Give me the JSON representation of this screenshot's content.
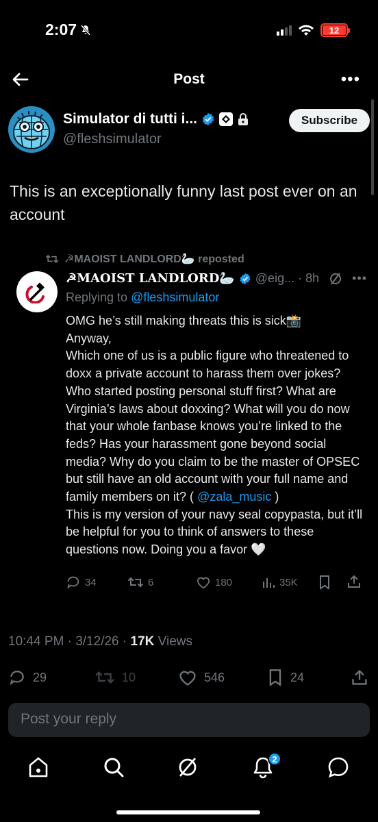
{
  "status_bar": {
    "time": "2:07",
    "battery": "12"
  },
  "nav": {
    "title": "Post"
  },
  "author": {
    "display_name": "Simulator di tutti i...",
    "handle": "@fleshsimulator",
    "subscribe_label": "Subscribe"
  },
  "post": {
    "text": "This is an exceptionally funny last post ever on an account",
    "timestamp_prefix": "10:44 PM · 3/12/26 · ",
    "views_count": "17K",
    "views_label": " Views",
    "stats": {
      "replies": "29",
      "reposts": "10",
      "likes": "546",
      "bookmarks": "24"
    }
  },
  "quoted": {
    "repost_label": "☭MAOIST LANDLORD🦢 reposted",
    "name": "☭MAOIST LANDLORD🦢",
    "meta": "@eig... · 8h",
    "replying_prefix": "Replying to ",
    "replying_handle": "@fleshsimulator",
    "body_part1": "OMG he’s still making threats this is sick📸\nAnyway,\nWhich one of us is a public figure who threatened to doxx a private account to harass them over jokes? Who started posting personal stuff first? What are Virginia’s laws about doxxing? What will you do now that your whole fanbase knows you’re linked to the feds? Has your harassment gone beyond social media? Why do you claim to be the master of OPSEC but still have an old account with your full name and family members on it? ( ",
    "body_mention": "@zala_music",
    "body_part2": " )\nThis is my version of your navy seal copypasta, but it’ll be helpful for you to think of answers to these questions now. Doing you a favor 🤍",
    "actions": {
      "replies": "34",
      "reposts": "6",
      "likes": "180",
      "views": "35K"
    }
  },
  "reply_box": {
    "placeholder": "Post your reply"
  },
  "tabbar": {
    "notifications_badge": "2"
  }
}
